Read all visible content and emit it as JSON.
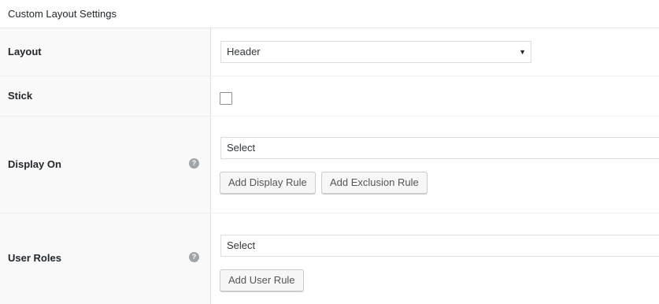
{
  "panel": {
    "title": "Custom Layout Settings"
  },
  "layout_row": {
    "label": "Layout",
    "select_value": "Header"
  },
  "stick_row": {
    "label": "Stick",
    "checked": false
  },
  "display_on_row": {
    "label": "Display On",
    "help_icon": "?",
    "select_placeholder": "Select",
    "add_display_rule_label": "Add Display Rule",
    "add_exclusion_rule_label": "Add Exclusion Rule"
  },
  "user_roles_row": {
    "label": "User Roles",
    "help_icon": "?",
    "select_placeholder": "Select",
    "add_user_rule_label": "Add User Rule"
  },
  "icons": {
    "dropdown": "chevron-down-icon",
    "help": "help-icon"
  }
}
